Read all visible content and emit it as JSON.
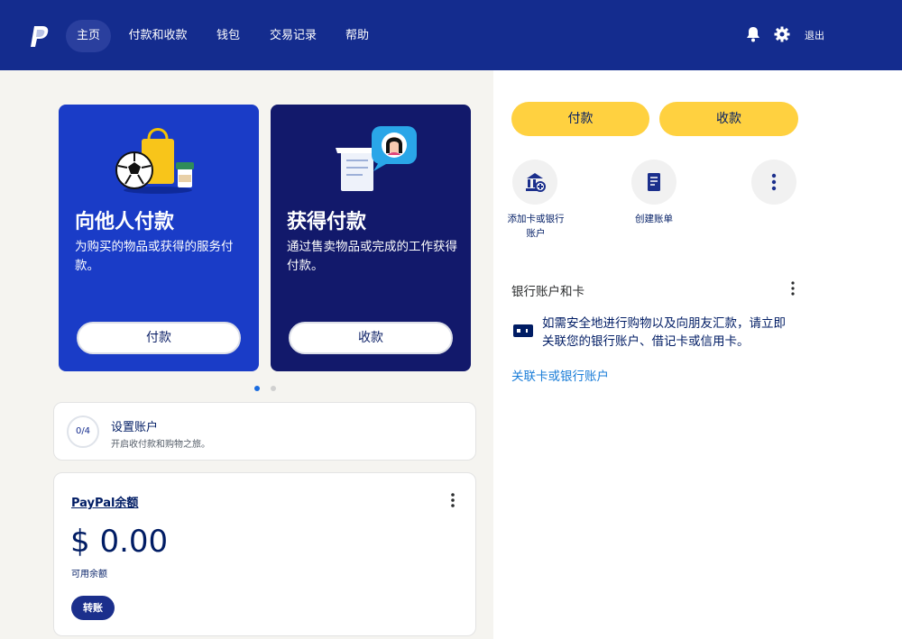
{
  "header": {
    "nav": [
      "主页",
      "付款和收款",
      "钱包",
      "交易记录",
      "帮助"
    ],
    "logout": "退出"
  },
  "cards": {
    "send": {
      "title": "向他人付款",
      "desc": "为购买的物品或获得的服务付款。",
      "button": "付款"
    },
    "receive": {
      "title": "获得付款",
      "desc": "通过售卖物品或完成的工作获得付款。",
      "button": "收款"
    }
  },
  "carousel": {
    "total": 2,
    "active": 1
  },
  "setup": {
    "progress": "0/4",
    "title": "设置账户",
    "subtitle": "开启收付款和购物之旅。"
  },
  "balance": {
    "label": "PayPal余额",
    "amount": "$ 0.00",
    "sub": "可用余额",
    "transfer": "转账"
  },
  "actions": {
    "pay": "付款",
    "request": "收款",
    "add_card": "添加卡或银行账户",
    "create_invoice": "创建账单"
  },
  "bank_section": {
    "title": "银行账户和卡",
    "desc": "如需安全地进行购物以及向朋友汇款，请立即关联您的银行账户、借记卡或信用卡。",
    "link": "关联卡或银行账户"
  },
  "colors": {
    "header": "#142c8e",
    "yellow": "#ffd140",
    "send_card": "#1a3cc7",
    "receive_card": "#12196b"
  }
}
